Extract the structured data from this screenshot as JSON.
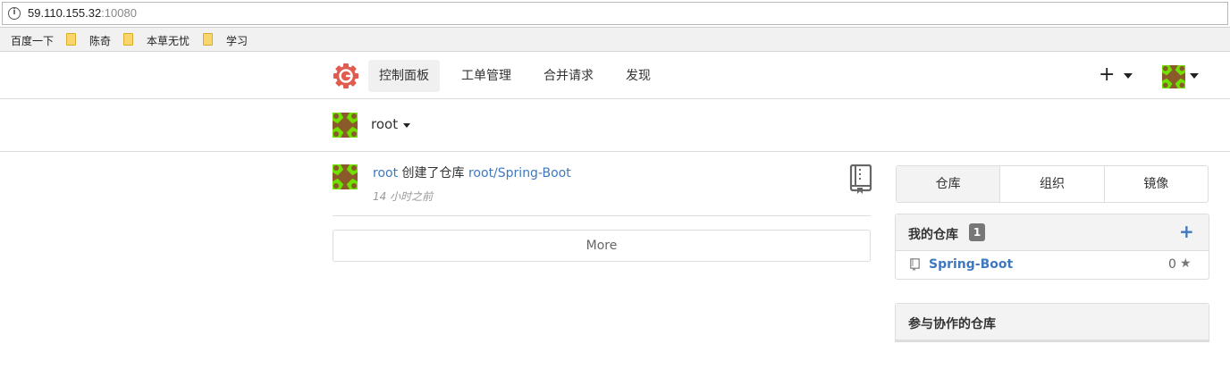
{
  "browser": {
    "url_host": "59.110.155.32",
    "url_port": ":10080",
    "bookmarks": [
      "百度一下",
      "陈奇",
      "本草无忧",
      "学习"
    ]
  },
  "nav": {
    "items": [
      "控制面板",
      "工单管理",
      "合并请求",
      "发现"
    ],
    "plus": "+"
  },
  "context": {
    "user": "root"
  },
  "feed": {
    "actor": "root",
    "action": "创建了仓库",
    "repo": "root/Spring-Boot",
    "time": "14 小时之前",
    "more": "More"
  },
  "sidebar": {
    "tabs": [
      "仓库",
      "组织",
      "镜像"
    ],
    "my_repos": {
      "title": "我的仓库",
      "count": "1",
      "add": "+",
      "repos": [
        {
          "name": "Spring-Boot",
          "stars": "0"
        }
      ]
    },
    "collab": {
      "title": "参与协作的仓库"
    }
  },
  "colors": {
    "link": "#4078c0",
    "avatar_bg": "#8a5a2b",
    "avatar_fg": "#6fe000",
    "logo": "#e05c50"
  }
}
